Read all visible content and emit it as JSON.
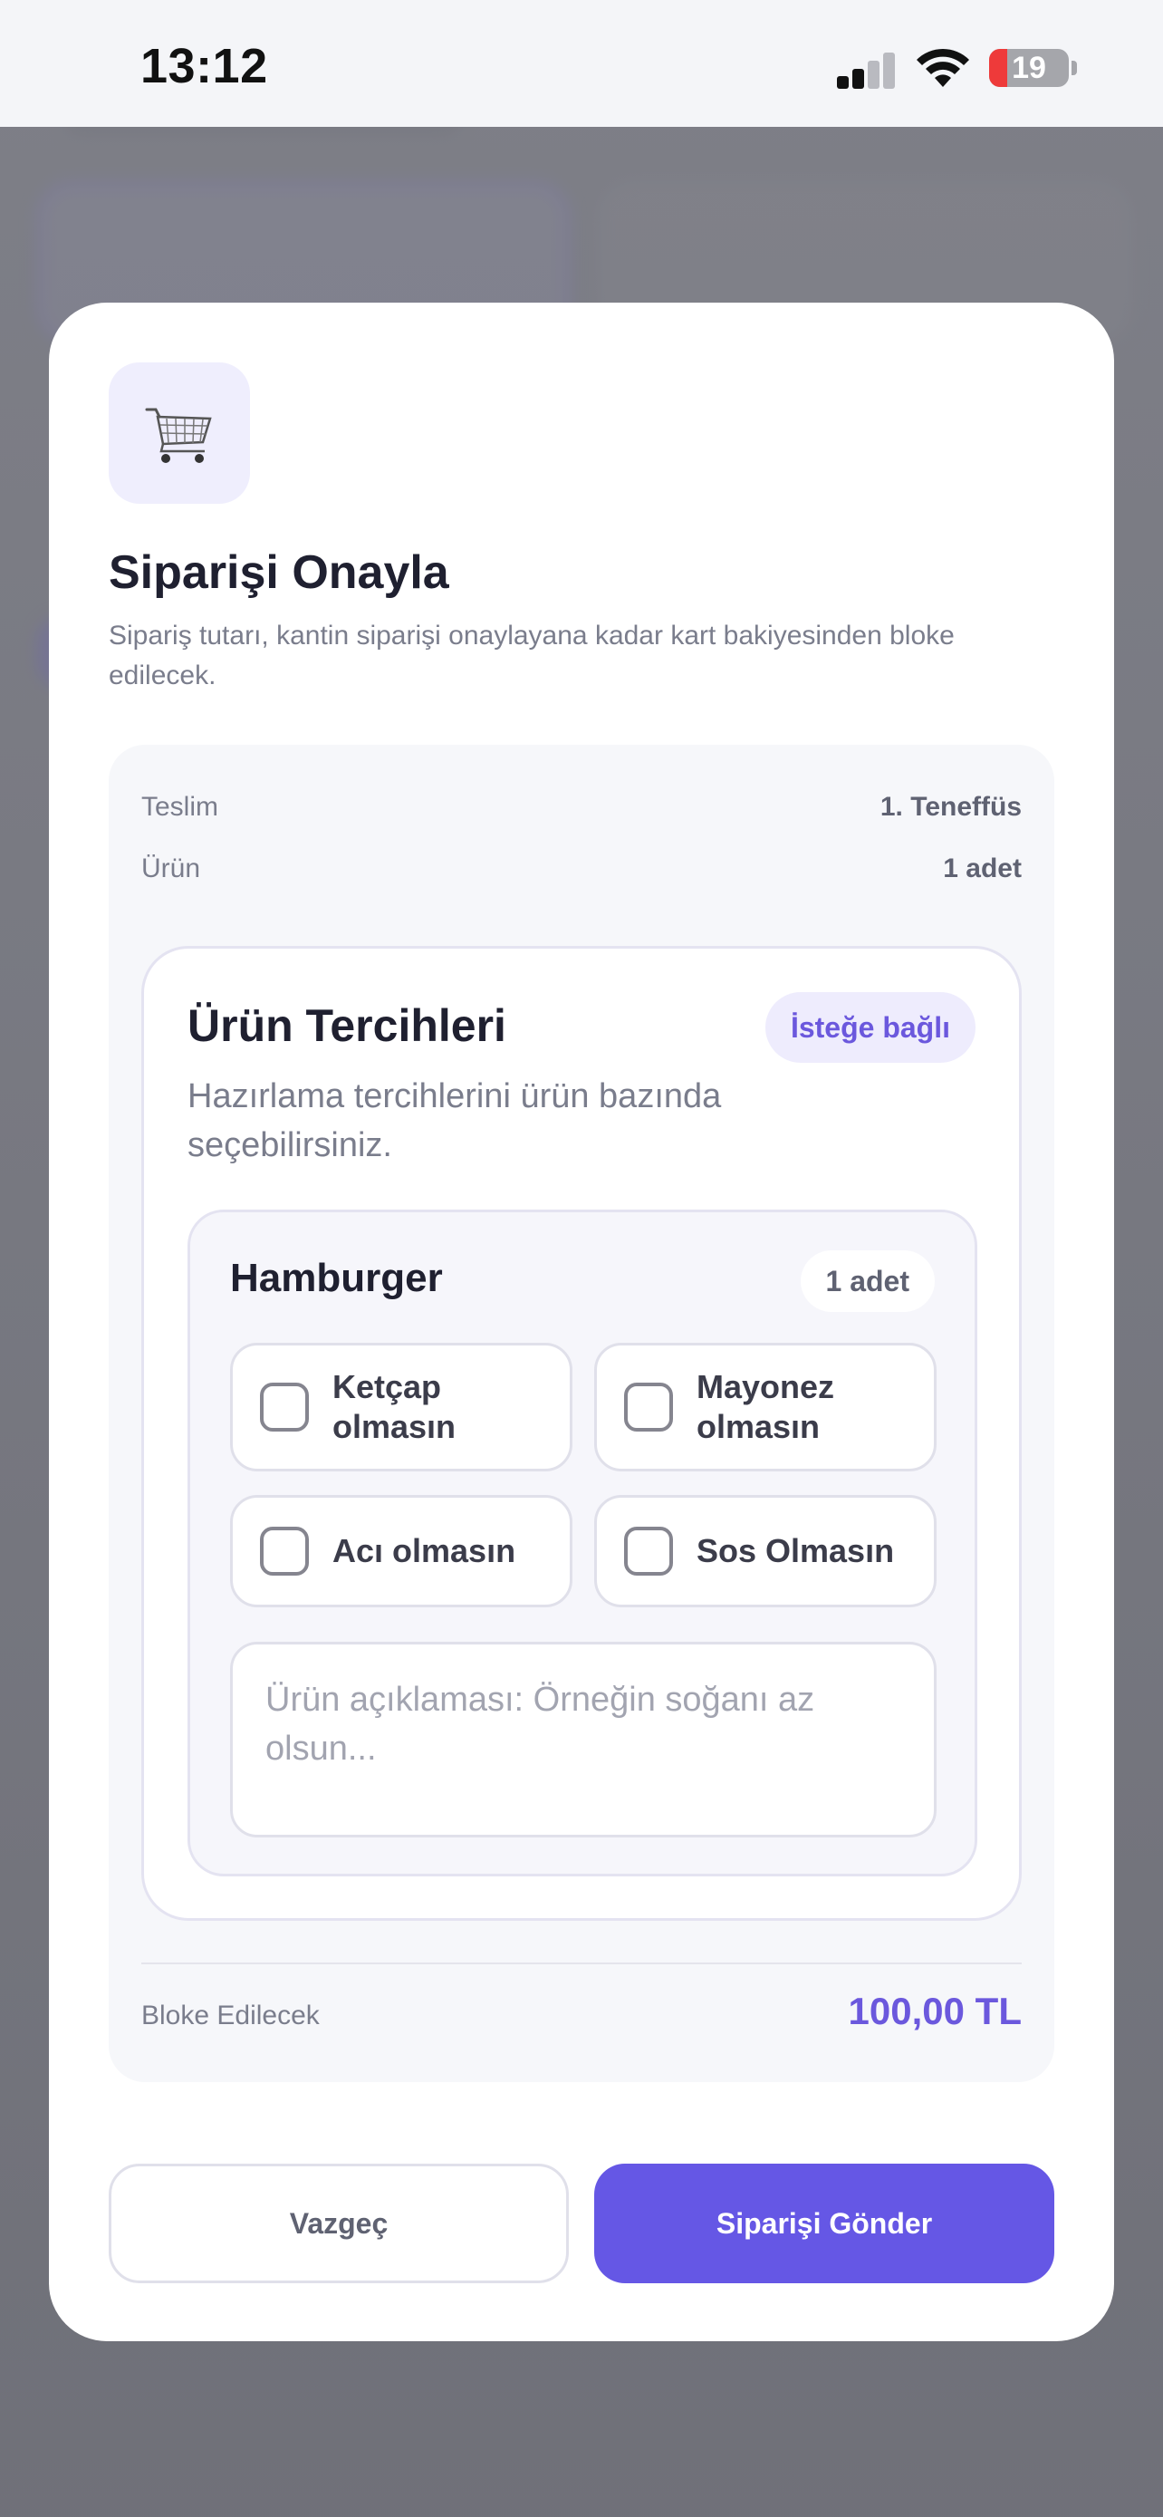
{
  "status_bar": {
    "time": "13:12",
    "battery": "19"
  },
  "modal": {
    "icon": "shopping-cart-icon",
    "title": "Siparişi Onayla",
    "subtitle": "Sipariş tutarı, kantin siparişi onaylayana kadar kart bakiyesinden bloke edilecek.",
    "summary": {
      "delivery_label": "Teslim",
      "delivery_value": "1. Teneffüs",
      "product_label": "Ürün",
      "product_value": "1 adet"
    },
    "preferences": {
      "title": "Ürün Tercihleri",
      "badge": "İsteğe bağlı",
      "description": "Hazırlama tercihlerini ürün bazında seçebilirsiniz.",
      "product": {
        "name": "Hamburger",
        "quantity": "1 adet",
        "options": [
          {
            "label": "Ketçap olmasın",
            "checked": false
          },
          {
            "label": "Mayonez olmasın",
            "checked": false
          },
          {
            "label": "Acı olmasın",
            "checked": false
          },
          {
            "label": "Sos Olmasın",
            "checked": false
          }
        ],
        "note_placeholder": "Ürün açıklaması: Örneğin soğanı az olsun..."
      }
    },
    "total_label": "Bloke Edilecek",
    "total_value": "100,00 TL",
    "cancel_label": "Vazgeç",
    "submit_label": "Siparişi Gönder"
  },
  "colors": {
    "accent": "#6557e5",
    "accent_text": "#6b58dd",
    "battery_low": "#ee3a3a"
  }
}
